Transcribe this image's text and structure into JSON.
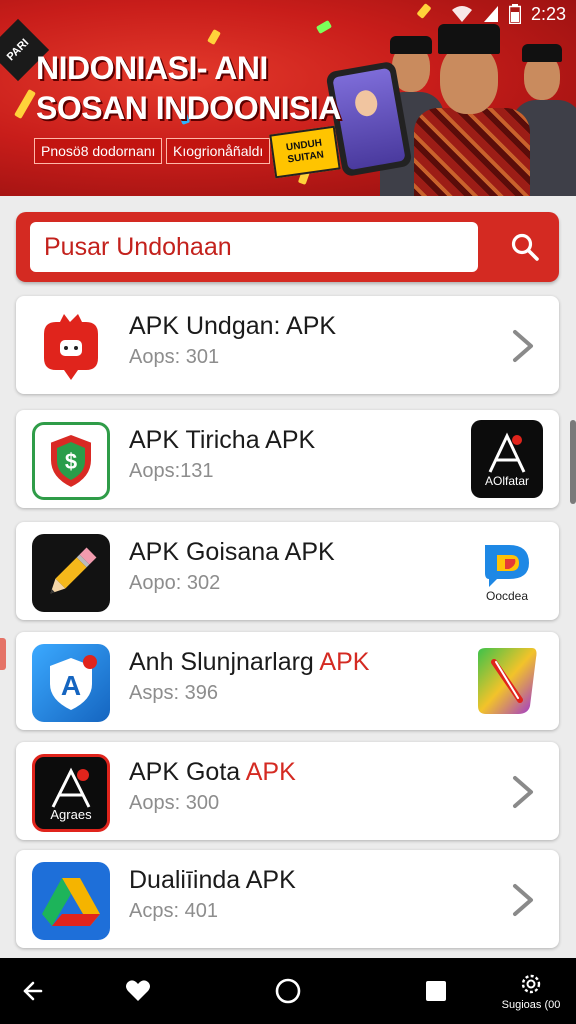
{
  "status_bar": {
    "time": "2:23"
  },
  "banner": {
    "corner_badge": "PARI",
    "headline_line1": "NIDONIASI- ANI",
    "headline_line2": "SOSAN INDOONISIA",
    "pill_left": "Pnosö8 dodornanı",
    "pill_right": "Kıogrionåñaldı",
    "sticker": "UNDUH SUITAN"
  },
  "search": {
    "placeholder": "Pusar Undohaan"
  },
  "list": [
    {
      "title": "APK Undgan: APK",
      "title_accent": "",
      "subtitle": "Aops: 301",
      "icon": "cute-mascot-icon",
      "trailing": "chevron"
    },
    {
      "title": "APK Tiricha APK",
      "title_accent": "",
      "subtitle": "Aops:131",
      "icon": "shield-dollar-icon",
      "trailing": "app-icon",
      "side_icon_label": "AOlfatar",
      "side_icon": "aolfatar-icon"
    },
    {
      "title": "APK Goisana APK",
      "title_accent": "",
      "subtitle": "Aopo: 302",
      "icon": "pencil-icon",
      "trailing": "app-icon",
      "side_icon_label": "Oocdea",
      "side_icon": "oocdea-logo-icon"
    },
    {
      "title": "Anh Slunjnarlarg ",
      "title_accent": "APK",
      "subtitle": "Asps: 396",
      "icon": "shield-a-icon",
      "trailing": "app-icon",
      "side_icon": "gradient-x-icon"
    },
    {
      "title": "APK Gota ",
      "title_accent": "APK",
      "subtitle": "Aops: 300",
      "icon": "agraes-icon",
      "icon_label": "Agraes",
      "trailing": "chevron"
    },
    {
      "title": "Dualiīinda APK",
      "title_accent": "",
      "subtitle": "Acps: 401",
      "icon": "triangle-drive-icon",
      "trailing": "chevron"
    }
  ],
  "nav": {
    "settings_label": "Sugioas (00"
  },
  "colors": {
    "accent": "#d42a22",
    "banner_red": "#c81d1a",
    "nav_bg": "#000000"
  }
}
